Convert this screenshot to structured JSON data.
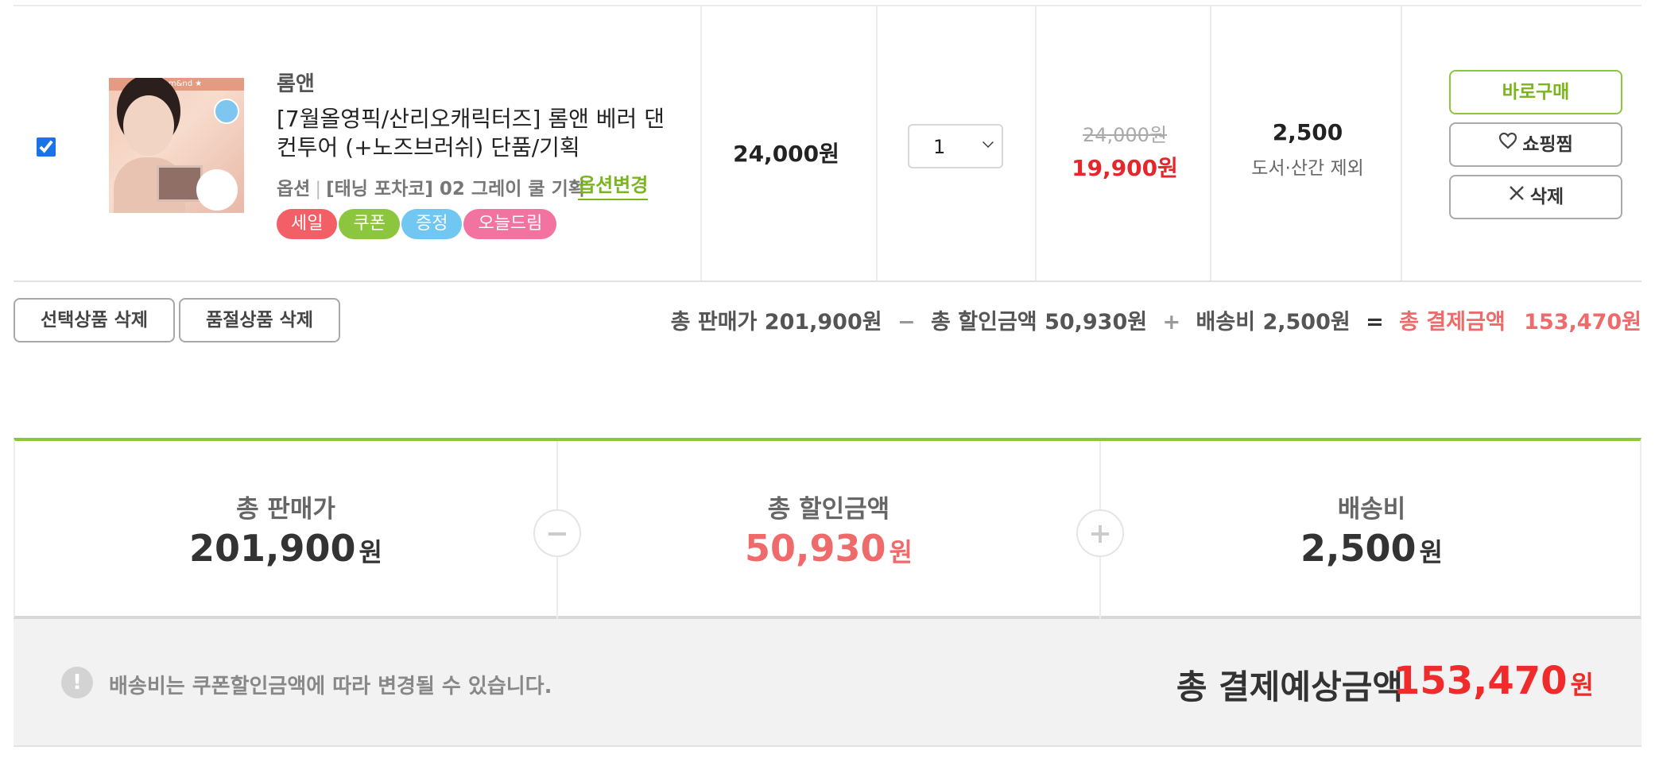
{
  "item": {
    "checked": true,
    "brand": "롬앤",
    "name": "[7월올영픽/산리오캐릭터즈] 롬앤 베러 댄 컨투어 (+노즈브러쉬) 단품/기획",
    "option_label": "옵션",
    "option_value": "[태닝 포차코] 02 그레이 쿨 기획",
    "option_change": "옵션변경",
    "tags": [
      {
        "label": "세일",
        "color": "#f25f67"
      },
      {
        "label": "쿠폰",
        "color": "#8cc63f"
      },
      {
        "label": "증정",
        "color": "#6fc7f2"
      },
      {
        "label": "오늘드림",
        "color": "#f2739f"
      }
    ],
    "unit_price": "24,000원",
    "quantity": "1",
    "original_price": "24,000원",
    "sale_price": "19,900원",
    "shipping_fee": "2,500",
    "shipping_note": "도서·산간 제외",
    "buttons": {
      "buy_now": "바로구매",
      "wishlist": "쇼핑찜",
      "delete": "삭제"
    }
  },
  "actions": {
    "delete_selected": "선택상품 삭제",
    "delete_soldout": "품절상품 삭제"
  },
  "calc": {
    "total_sale_label": "총 판매가",
    "total_sale": "201,900원",
    "minus": "−",
    "total_discount_label": "총 할인금액",
    "total_discount": "50,930원",
    "plus": "+",
    "shipping_label": "배송비",
    "shipping": "2,500원",
    "equals": "=",
    "total_payment_label": "총 결제금액",
    "total_payment": "153,470원"
  },
  "summary": {
    "sale_label": "총 판매가",
    "sale_amount": "201,900",
    "discount_label": "총 할인금액",
    "discount_amount": "50,930",
    "shipping_label": "배송비",
    "shipping_amount": "2,500",
    "unit": "원",
    "notice": "배송비는 쿠폰할인금액에 따라 변경될 수 있습니다.",
    "final_label": "총 결제예상금액",
    "final_amount": "153,470"
  },
  "colors": {
    "accent_green": "#8cc63f",
    "sale_red": "#e5262a",
    "discount_coral": "#ef6a6a"
  }
}
